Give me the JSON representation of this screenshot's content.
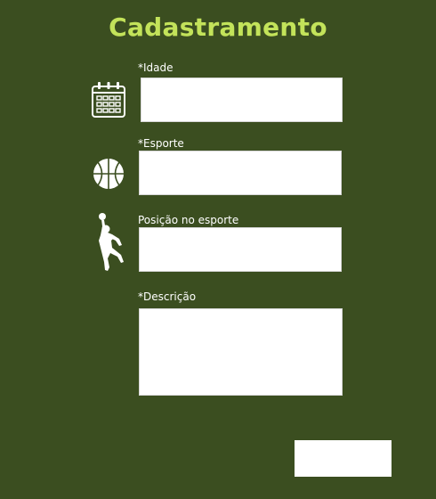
{
  "app": {
    "title": "Cadastramento"
  },
  "form": {
    "fields": [
      {
        "key": "idade",
        "label": "*Idade",
        "icon": "calendar-icon",
        "value": ""
      },
      {
        "key": "esporte",
        "label": "*Esporte",
        "icon": "basketball-icon",
        "value": ""
      },
      {
        "key": "posicao",
        "label": "Posição no esporte",
        "icon": "basketball-player-icon",
        "value": ""
      },
      {
        "key": "descricao",
        "label": "*Descrição",
        "icon": "",
        "value": ""
      }
    ],
    "submit_label": ""
  },
  "colors": {
    "background": "#3b4e20",
    "title": "#c3e35a",
    "label": "#ffffff",
    "field": "#ffffff"
  }
}
